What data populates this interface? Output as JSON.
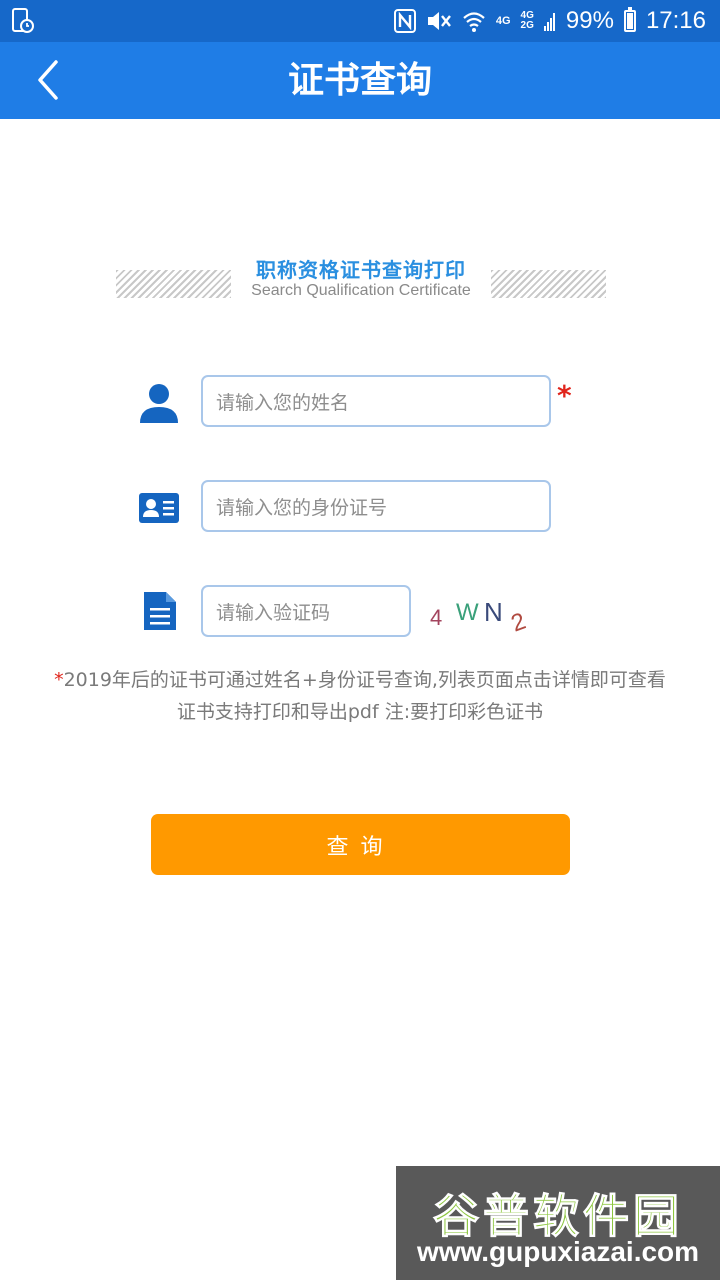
{
  "status_bar": {
    "network_small": "4G",
    "network_stack_top": "4G",
    "network_stack_bottom": "2G",
    "battery": "99%",
    "time": "17:16"
  },
  "app_bar": {
    "title": "证书查询",
    "back_icon": "chevron-left-icon"
  },
  "banner": {
    "title": "职称资格证书查询打印",
    "subtitle": "Search Qualification Certificate"
  },
  "form": {
    "name": {
      "placeholder": "请输入您的姓名",
      "icon": "user-icon",
      "required_mark": "*"
    },
    "id_number": {
      "placeholder": "请输入您的身份证号",
      "icon": "id-card-icon"
    },
    "captcha": {
      "placeholder": "请输入验证码",
      "icon": "document-icon",
      "chars": [
        "4",
        "W",
        "N",
        "2"
      ]
    }
  },
  "note": {
    "star": "*",
    "line1": "2019年后的证书可通过姓名+身份证号查询,列表页面点击详情即可查看",
    "line2": "证书支持打印和导出pdf 注:要打印彩色证书"
  },
  "query_button": {
    "label": "查询"
  },
  "watermark": {
    "main": "谷普软件园",
    "url": "www.gupuxiazai.com"
  },
  "colors": {
    "status_bar": "#1668c9",
    "app_bar": "#1f7de6",
    "accent_button": "#ff9900",
    "required": "#e0241b",
    "icon_blue": "#1565c0"
  }
}
